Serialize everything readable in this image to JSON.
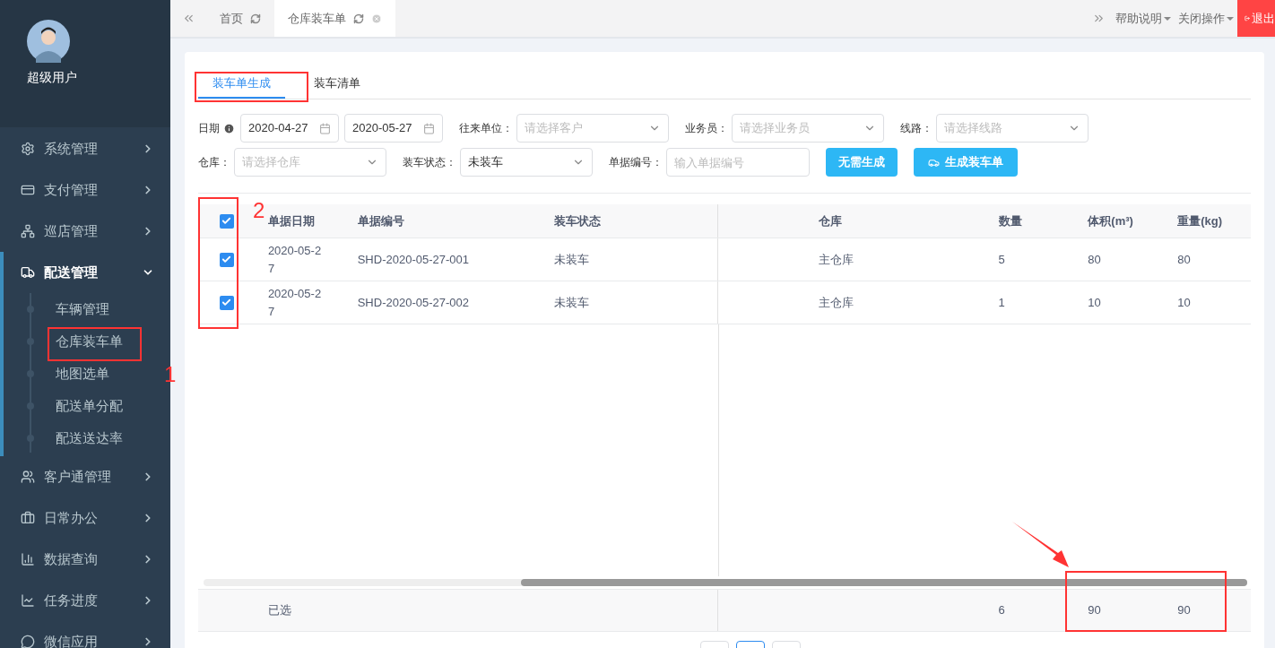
{
  "user": {
    "name": "超级用户"
  },
  "sidebar": {
    "items": [
      {
        "label": "系统管理",
        "expanded": false
      },
      {
        "label": "支付管理",
        "expanded": false
      },
      {
        "label": "巡店管理",
        "expanded": false
      },
      {
        "label": "配送管理",
        "expanded": true,
        "children": [
          {
            "label": "车辆管理"
          },
          {
            "label": "仓库装车单"
          },
          {
            "label": "地图选单"
          },
          {
            "label": "配送单分配"
          },
          {
            "label": "配送送达率"
          }
        ]
      },
      {
        "label": "客户通管理",
        "expanded": false
      },
      {
        "label": "日常办公",
        "expanded": false
      },
      {
        "label": "数据查询",
        "expanded": false
      },
      {
        "label": "任务进度",
        "expanded": false
      },
      {
        "label": "微信应用",
        "expanded": false
      }
    ]
  },
  "top_tabs": [
    {
      "label": "首页",
      "selected": false
    },
    {
      "label": "仓库装车单",
      "selected": true
    }
  ],
  "top_actions": {
    "help": "帮助说明",
    "close": "关闭操作",
    "logout": "退出"
  },
  "page_tabs": [
    {
      "label": "装车单生成",
      "selected": true
    },
    {
      "label": "装车清单",
      "selected": false
    }
  ],
  "filters": [
    {
      "kind": "daterange",
      "label": "日期",
      "from": "2020-04-27",
      "to": "2020-05-27"
    },
    {
      "kind": "select",
      "label": "往来单位：",
      "placeholder": "请选择客户"
    },
    {
      "kind": "select",
      "label": "业务员：",
      "placeholder": "请选择业务员"
    },
    {
      "kind": "select",
      "label": "线路：",
      "placeholder": "请选择线路"
    },
    {
      "kind": "select",
      "label": "仓库：",
      "placeholder": "请选择仓库"
    },
    {
      "kind": "select",
      "label": "装车状态：",
      "value": "未装车"
    },
    {
      "kind": "input",
      "label": "单据编号：",
      "placeholder": "输入单据编号"
    }
  ],
  "buttons": [
    {
      "label": "无需生成"
    },
    {
      "label": "生成装车单"
    }
  ],
  "table": {
    "all_checked": true,
    "columns": [
      "单据日期",
      "单据编号",
      "装车状态",
      "仓库",
      "数量",
      "体积(m³)",
      "重量(kg)"
    ],
    "rows": [
      {
        "checked": true,
        "cells": [
          "2020-05-2\n7",
          "SHD-2020-05-27-001",
          "未装车",
          "主仓库",
          "5",
          "80",
          "80"
        ]
      },
      {
        "checked": true,
        "cells": [
          "2020-05-2\n7",
          "SHD-2020-05-27-002",
          "未装车",
          "主仓库",
          "1",
          "10",
          "10"
        ]
      }
    ],
    "footer": {
      "label": "已选",
      "quantity": "6",
      "volume": "90",
      "weight": "90"
    }
  },
  "annotations": [
    "1",
    "2"
  ]
}
